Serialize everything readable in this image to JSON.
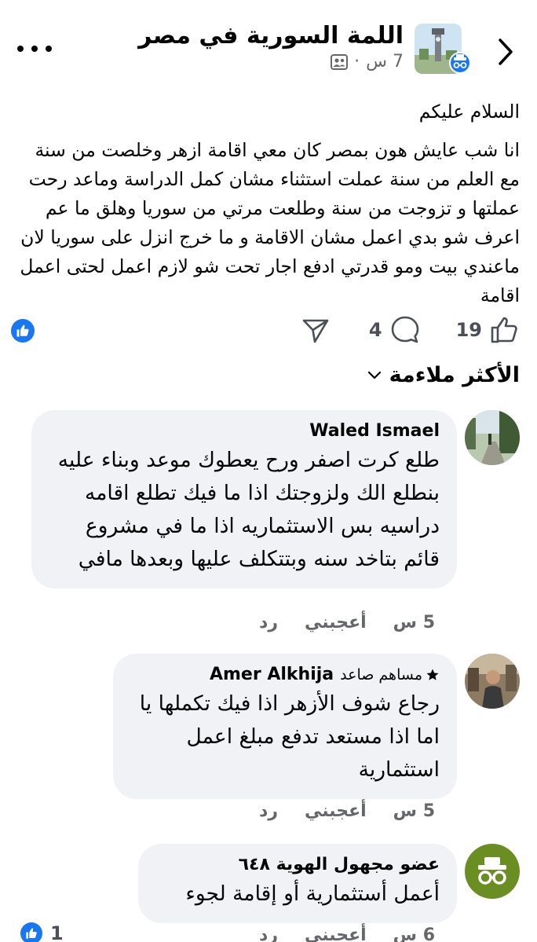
{
  "header": {
    "group_name": "اللمة السورية في مصر",
    "time": "7 س",
    "separator": "·",
    "audience_icon": "group-audience-icon",
    "back_icon": "chevron-right-icon",
    "more_icon": "more-dots-icon"
  },
  "post": {
    "greeting": "السلام عليكم",
    "body": "انا شب عايش هون بمصر كان معي اقامة ازهر وخلصت من سنة  مع العلم من سنة عملت استثناء مشان كمل الدراسة وماعد رحت عملتها و تزوجت من سنة وطلعت مرتي من سوريا وهلق ما عم اعرف شو بدي اعمل مشان الاقامة و ما خرج انزل على سوريا لان ماعندي بيت ومو قدرتي ادفع اجار تحت شو لازم اعمل لحتى اعمل اقامة"
  },
  "reactions": {
    "like_count": "19",
    "comment_count": "4",
    "like_icon": "thumbs-up-icon",
    "comment_icon": "comment-bubble-icon",
    "share_icon": "share-arrow-icon",
    "reaction_badge_icon": "like-badge-icon"
  },
  "sort": {
    "label": "الأكثر ملاءمة",
    "icon": "chevron-down-icon"
  },
  "comments": [
    {
      "author": "Waled Ismael",
      "text": "طلع كرت اصفر ورح يعطوك موعد وبناء عليه بنطلع الك ولزوجتك اذا ما فيك تطلع اقامه دراسيه بس الاستثماريه اذا ما في مشروع قائم بتاخد سنه وبتتكلف عليها وبعدها مافي",
      "time": "5 س",
      "like_label": "أعجبني",
      "reply_label": "رد"
    },
    {
      "author": "Amer Alkhija",
      "badge": "مساهم صاعد",
      "text": "رجاع شوف الأزهر اذا فيك تكملها يا اما اذا مستعد تدفع مبلغ اعمل استثمارية",
      "time": "5 س",
      "like_label": "أعجبني",
      "reply_label": "رد"
    },
    {
      "author": "عضو مجهول الهوية ٦٤٨",
      "text": "أعمل أستثمارية أو إقامة لجوء",
      "time": "6 س",
      "like_label": "أعجبني",
      "reply_label": "رد",
      "reaction_count": "1"
    }
  ],
  "colors": {
    "facebook_blue": "#1877f2",
    "bubble": "#f0f2f5",
    "secondary_text": "#65676b",
    "anonymous_avatar": "#6b8e23"
  }
}
